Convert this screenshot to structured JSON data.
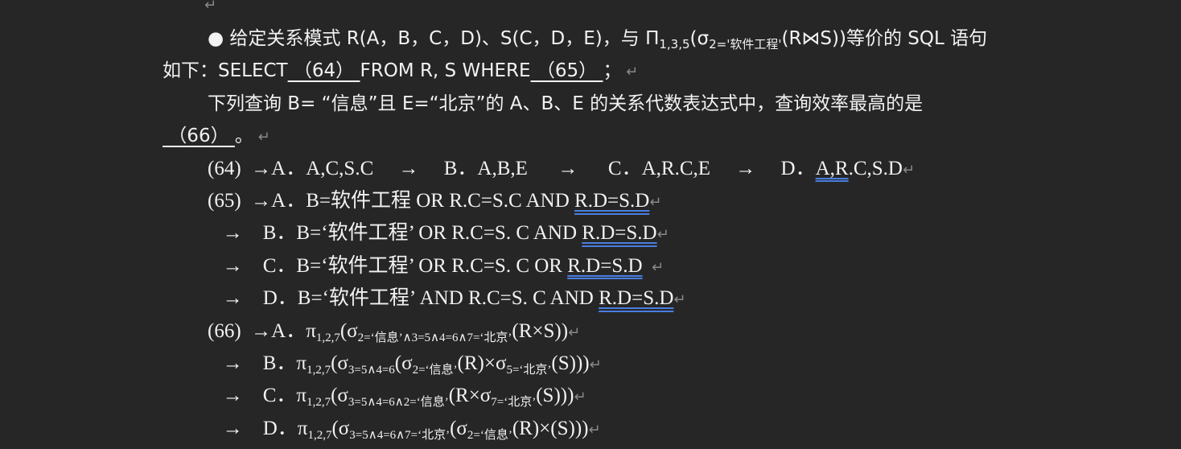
{
  "top_mark": "↵",
  "lines": [
    {
      "indent": "first",
      "serif": false,
      "segs": [
        {
          "k": "n",
          "t": "● "
        },
        {
          "k": "n",
          "t": "给定关系模式 R(A，B，C，D)、S(C，D，E)，与 "
        },
        {
          "k": "n",
          "t": "Π"
        },
        {
          "k": "s",
          "t": "1,3,5"
        },
        {
          "k": "n",
          "t": "(σ"
        },
        {
          "k": "s",
          "t": "2='软件工程'"
        },
        {
          "k": "n",
          "t": "(R⋈S))等价的 SQL 语句"
        }
      ]
    },
    {
      "indent": "hang",
      "serif": false,
      "segs": [
        {
          "k": "n",
          "t": "如下：SELECT"
        },
        {
          "k": "u",
          "t": " （64） "
        },
        {
          "k": "n",
          "t": "FROM R, S WHERE"
        },
        {
          "k": "u",
          "t": " （65） "
        },
        {
          "k": "n",
          "t": "；"
        },
        {
          "k": "m",
          "t": " ↵"
        }
      ]
    },
    {
      "indent": "first",
      "serif": false,
      "segs": [
        {
          "k": "n",
          "t": "下列查询 B= “信息”且 E=“北京”的 A、B、E 的关系代数表达式中，查询效率最高的是"
        }
      ]
    },
    {
      "indent": "hang",
      "serif": false,
      "segs": [
        {
          "k": "u",
          "t": " （66） "
        },
        {
          "k": "n",
          "t": "。"
        },
        {
          "k": "m",
          "t": " ↵"
        }
      ]
    },
    {
      "indent": "first",
      "serif": true,
      "segs": [
        {
          "k": "n",
          "t": "(64)  →A．A,C,S.C     →     B．A,B,E      →      C．A,R.C,E     →     D．"
        },
        {
          "k": "d",
          "t": "A,R"
        },
        {
          "k": "n",
          "t": ".C,S.D"
        },
        {
          "k": "m",
          "t": "↵"
        }
      ]
    },
    {
      "indent": "first",
      "serif": true,
      "segs": [
        {
          "k": "n",
          "t": "(65)  →A．B=软件工程 OR R.C=S.C AND "
        },
        {
          "k": "d",
          "t": "R.D=S.D"
        },
        {
          "k": "m",
          "t": "↵"
        }
      ]
    },
    {
      "indent": "first",
      "serif": true,
      "segs": [
        {
          "k": "n",
          "t": "   →    B．B=‘软件工程’ OR R.C=S. C AND "
        },
        {
          "k": "d",
          "t": "R.D=S.D"
        },
        {
          "k": "m",
          "t": "↵"
        }
      ]
    },
    {
      "indent": "first",
      "serif": true,
      "segs": [
        {
          "k": "n",
          "t": "   →    C．B=‘软件工程’ OR R.C=S. C OR "
        },
        {
          "k": "d",
          "t": "R.D=S.D"
        },
        {
          "k": "m",
          "t": "  ↵"
        }
      ]
    },
    {
      "indent": "first",
      "serif": true,
      "segs": [
        {
          "k": "n",
          "t": "   →    D．B=‘软件工程’ AND R.C=S. C AND "
        },
        {
          "k": "d",
          "t": "R.D=S.D"
        },
        {
          "k": "m",
          "t": "↵"
        }
      ]
    },
    {
      "indent": "first",
      "serif": true,
      "segs": [
        {
          "k": "n",
          "t": "(66)  →A．π"
        },
        {
          "k": "s",
          "t": "1,2,7"
        },
        {
          "k": "n",
          "t": "(σ"
        },
        {
          "k": "s",
          "t": "2=‘信息’∧3=5∧4=6∧7=‘北京’"
        },
        {
          "k": "n",
          "t": "(R×S))"
        },
        {
          "k": "m",
          "t": "↵"
        }
      ]
    },
    {
      "indent": "first",
      "serif": true,
      "segs": [
        {
          "k": "n",
          "t": "   →    B．π"
        },
        {
          "k": "s",
          "t": "1,2,7"
        },
        {
          "k": "n",
          "t": "(σ"
        },
        {
          "k": "s",
          "t": "3=5∧4=6"
        },
        {
          "k": "n",
          "t": "(σ"
        },
        {
          "k": "s",
          "t": "2=‘信息’"
        },
        {
          "k": "n",
          "t": "(R)×σ"
        },
        {
          "k": "s",
          "t": "5=‘北京’"
        },
        {
          "k": "n",
          "t": "(S)))"
        },
        {
          "k": "m",
          "t": "↵"
        }
      ]
    },
    {
      "indent": "first",
      "serif": true,
      "segs": [
        {
          "k": "n",
          "t": "   →    C．π"
        },
        {
          "k": "s",
          "t": "1,2,7"
        },
        {
          "k": "n",
          "t": "(σ"
        },
        {
          "k": "s",
          "t": "3=5∧4=6∧2=‘信息’"
        },
        {
          "k": "n",
          "t": "(R×σ"
        },
        {
          "k": "s",
          "t": "7=‘北京’"
        },
        {
          "k": "n",
          "t": "(S)))"
        },
        {
          "k": "m",
          "t": "↵"
        }
      ]
    },
    {
      "indent": "first",
      "serif": true,
      "segs": [
        {
          "k": "n",
          "t": "   →    D．π"
        },
        {
          "k": "s",
          "t": "1,2,7"
        },
        {
          "k": "n",
          "t": "(σ"
        },
        {
          "k": "s",
          "t": "3=5∧4=6∧7=‘北京’"
        },
        {
          "k": "n",
          "t": "(σ"
        },
        {
          "k": "s",
          "t": "2=‘信息’"
        },
        {
          "k": "n",
          "t": "(R)×(S)))"
        },
        {
          "k": "m",
          "t": "↵"
        }
      ]
    }
  ]
}
